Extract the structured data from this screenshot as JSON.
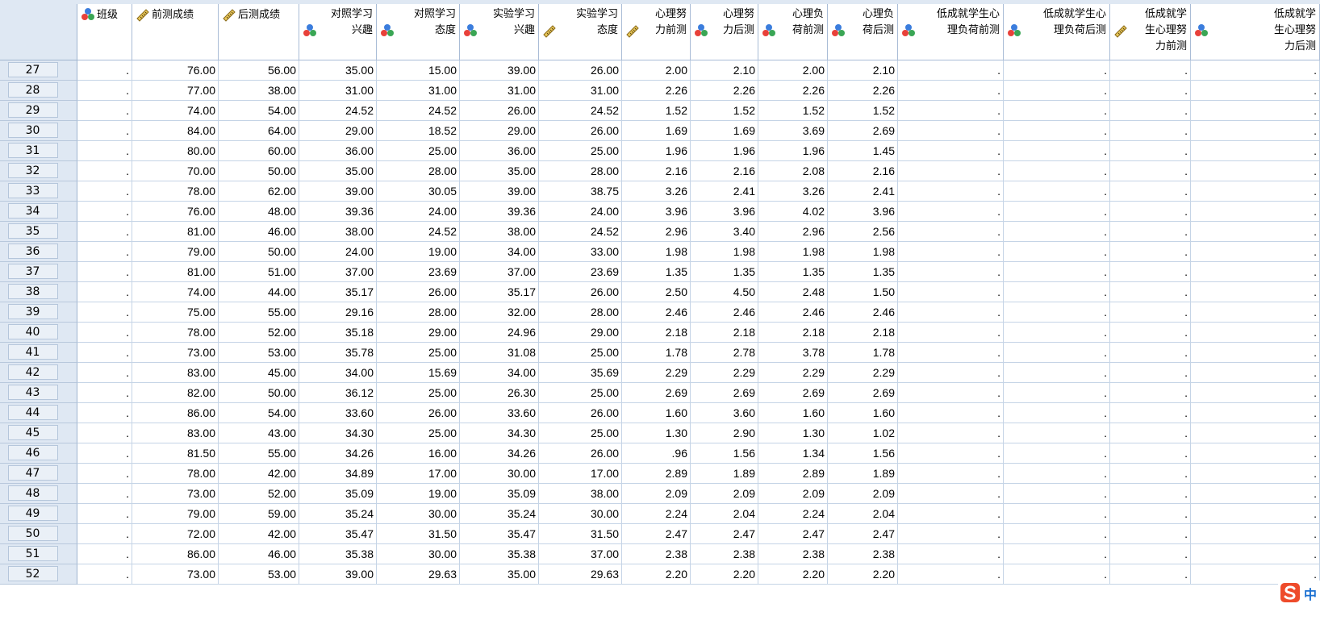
{
  "columns": [
    {
      "label": "班级",
      "icon": "nominal-icon"
    },
    {
      "label": "前测成绩",
      "icon": "scale-icon"
    },
    {
      "label": "后测成绩",
      "icon": "scale-icon"
    },
    {
      "label": "对照学习\n兴趣",
      "icon": "nominal-icon"
    },
    {
      "label": "对照学习\n态度",
      "icon": "nominal-icon"
    },
    {
      "label": "实验学习\n兴趣",
      "icon": "nominal-icon"
    },
    {
      "label": "实验学习\n态度",
      "icon": "scale-icon"
    },
    {
      "label": "心理努\n力前测",
      "icon": "scale-icon"
    },
    {
      "label": "心理努\n力后测",
      "icon": "nominal-icon"
    },
    {
      "label": "心理负\n荷前测",
      "icon": "nominal-icon"
    },
    {
      "label": "心理负\n荷后测",
      "icon": "nominal-icon"
    },
    {
      "label": "低成就学生心\n理负荷前测",
      "icon": "nominal-icon"
    },
    {
      "label": "低成就学生心\n理负荷后测",
      "icon": "nominal-icon"
    },
    {
      "label": "低成就学\n生心理努\n力前测",
      "icon": "scale-icon"
    },
    {
      "label": "低成就学\n生心理努\n力后测",
      "icon": "nominal-icon"
    }
  ],
  "rows": [
    {
      "num": "27",
      "cells": [
        ".",
        "76.00",
        "56.00",
        "35.00",
        "15.00",
        "39.00",
        "26.00",
        "2.00",
        "2.10",
        "2.00",
        "2.10",
        ".",
        ".",
        ".",
        "."
      ]
    },
    {
      "num": "28",
      "cells": [
        ".",
        "77.00",
        "38.00",
        "31.00",
        "31.00",
        "31.00",
        "31.00",
        "2.26",
        "2.26",
        "2.26",
        "2.26",
        ".",
        ".",
        ".",
        "."
      ]
    },
    {
      "num": "29",
      "cells": [
        ".",
        "74.00",
        "54.00",
        "24.52",
        "24.52",
        "26.00",
        "24.52",
        "1.52",
        "1.52",
        "1.52",
        "1.52",
        ".",
        ".",
        ".",
        "."
      ]
    },
    {
      "num": "30",
      "cells": [
        ".",
        "84.00",
        "64.00",
        "29.00",
        "18.52",
        "29.00",
        "26.00",
        "1.69",
        "1.69",
        "3.69",
        "2.69",
        ".",
        ".",
        ".",
        "."
      ]
    },
    {
      "num": "31",
      "cells": [
        ".",
        "80.00",
        "60.00",
        "36.00",
        "25.00",
        "36.00",
        "25.00",
        "1.96",
        "1.96",
        "1.96",
        "1.45",
        ".",
        ".",
        ".",
        "."
      ]
    },
    {
      "num": "32",
      "cells": [
        ".",
        "70.00",
        "50.00",
        "35.00",
        "28.00",
        "35.00",
        "28.00",
        "2.16",
        "2.16",
        "2.08",
        "2.16",
        ".",
        ".",
        ".",
        "."
      ]
    },
    {
      "num": "33",
      "cells": [
        ".",
        "78.00",
        "62.00",
        "39.00",
        "30.05",
        "39.00",
        "38.75",
        "3.26",
        "2.41",
        "3.26",
        "2.41",
        ".",
        ".",
        ".",
        "."
      ]
    },
    {
      "num": "34",
      "cells": [
        ".",
        "76.00",
        "48.00",
        "39.36",
        "24.00",
        "39.36",
        "24.00",
        "3.96",
        "3.96",
        "4.02",
        "3.96",
        ".",
        ".",
        ".",
        "."
      ]
    },
    {
      "num": "35",
      "cells": [
        ".",
        "81.00",
        "46.00",
        "38.00",
        "24.52",
        "38.00",
        "24.52",
        "2.96",
        "3.40",
        "2.96",
        "2.56",
        ".",
        ".",
        ".",
        "."
      ]
    },
    {
      "num": "36",
      "cells": [
        ".",
        "79.00",
        "50.00",
        "24.00",
        "19.00",
        "34.00",
        "33.00",
        "1.98",
        "1.98",
        "1.98",
        "1.98",
        ".",
        ".",
        ".",
        "."
      ]
    },
    {
      "num": "37",
      "cells": [
        ".",
        "81.00",
        "51.00",
        "37.00",
        "23.69",
        "37.00",
        "23.69",
        "1.35",
        "1.35",
        "1.35",
        "1.35",
        ".",
        ".",
        ".",
        "."
      ]
    },
    {
      "num": "38",
      "cells": [
        ".",
        "74.00",
        "44.00",
        "35.17",
        "26.00",
        "35.17",
        "26.00",
        "2.50",
        "4.50",
        "2.48",
        "1.50",
        ".",
        ".",
        ".",
        "."
      ]
    },
    {
      "num": "39",
      "cells": [
        ".",
        "75.00",
        "55.00",
        "29.16",
        "28.00",
        "32.00",
        "28.00",
        "2.46",
        "2.46",
        "2.46",
        "2.46",
        ".",
        ".",
        ".",
        "."
      ]
    },
    {
      "num": "40",
      "cells": [
        ".",
        "78.00",
        "52.00",
        "35.18",
        "29.00",
        "24.96",
        "29.00",
        "2.18",
        "2.18",
        "2.18",
        "2.18",
        ".",
        ".",
        ".",
        "."
      ]
    },
    {
      "num": "41",
      "cells": [
        ".",
        "73.00",
        "53.00",
        "35.78",
        "25.00",
        "31.08",
        "25.00",
        "1.78",
        "2.78",
        "3.78",
        "1.78",
        ".",
        ".",
        ".",
        "."
      ]
    },
    {
      "num": "42",
      "cells": [
        ".",
        "83.00",
        "45.00",
        "34.00",
        "15.69",
        "34.00",
        "35.69",
        "2.29",
        "2.29",
        "2.29",
        "2.29",
        ".",
        ".",
        ".",
        "."
      ]
    },
    {
      "num": "43",
      "cells": [
        ".",
        "82.00",
        "50.00",
        "36.12",
        "25.00",
        "26.30",
        "25.00",
        "2.69",
        "2.69",
        "2.69",
        "2.69",
        ".",
        ".",
        ".",
        "."
      ]
    },
    {
      "num": "44",
      "cells": [
        ".",
        "86.00",
        "54.00",
        "33.60",
        "26.00",
        "33.60",
        "26.00",
        "1.60",
        "3.60",
        "1.60",
        "1.60",
        ".",
        ".",
        ".",
        "."
      ]
    },
    {
      "num": "45",
      "cells": [
        ".",
        "83.00",
        "43.00",
        "34.30",
        "25.00",
        "34.30",
        "25.00",
        "1.30",
        "2.90",
        "1.30",
        "1.02",
        ".",
        ".",
        ".",
        "."
      ]
    },
    {
      "num": "46",
      "cells": [
        ".",
        "81.50",
        "55.00",
        "34.26",
        "16.00",
        "34.26",
        "26.00",
        ".96",
        "1.56",
        "1.34",
        "1.56",
        ".",
        ".",
        ".",
        "."
      ]
    },
    {
      "num": "47",
      "cells": [
        ".",
        "78.00",
        "42.00",
        "34.89",
        "17.00",
        "30.00",
        "17.00",
        "2.89",
        "1.89",
        "2.89",
        "1.89",
        ".",
        ".",
        ".",
        "."
      ]
    },
    {
      "num": "48",
      "cells": [
        ".",
        "73.00",
        "52.00",
        "35.09",
        "19.00",
        "35.09",
        "38.00",
        "2.09",
        "2.09",
        "2.09",
        "2.09",
        ".",
        ".",
        ".",
        "."
      ]
    },
    {
      "num": "49",
      "cells": [
        ".",
        "79.00",
        "59.00",
        "35.24",
        "30.00",
        "35.24",
        "30.00",
        "2.24",
        "2.04",
        "2.24",
        "2.04",
        ".",
        ".",
        ".",
        "."
      ]
    },
    {
      "num": "50",
      "cells": [
        ".",
        "72.00",
        "42.00",
        "35.47",
        "31.50",
        "35.47",
        "31.50",
        "2.47",
        "2.47",
        "2.47",
        "2.47",
        ".",
        ".",
        ".",
        "."
      ]
    },
    {
      "num": "51",
      "cells": [
        ".",
        "86.00",
        "46.00",
        "35.38",
        "30.00",
        "35.38",
        "37.00",
        "2.38",
        "2.38",
        "2.38",
        "2.38",
        ".",
        ".",
        ".",
        "."
      ]
    },
    {
      "num": "52",
      "cells": [
        ".",
        "73.00",
        "53.00",
        "39.00",
        "29.63",
        "35.00",
        "29.63",
        "2.20",
        "2.20",
        "2.20",
        "2.20",
        ".",
        ".",
        ".",
        "."
      ]
    }
  ],
  "ime": {
    "label": "中",
    "icon": "sogou-ime-icon"
  },
  "colors": {
    "header_bg": "#dfe8f3",
    "grid": "#c5d4e6",
    "nominal_red": "#e8413a",
    "nominal_green": "#3aa655",
    "nominal_blue": "#3b7ddd",
    "scale_ruler": "#d9b44a"
  }
}
